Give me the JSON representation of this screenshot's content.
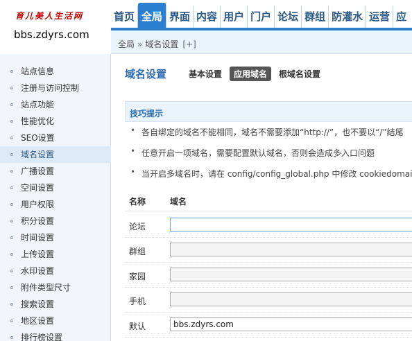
{
  "logo": {
    "calligraphy": "育儿美人生活网",
    "domain": "bbs.zdyrs.com"
  },
  "topnav": [
    "首页",
    "全局",
    "界面",
    "内容",
    "用户",
    "门户",
    "论坛",
    "群组",
    "防灌水",
    "运营",
    "应"
  ],
  "breadcrumb": {
    "root": "全局",
    "separator": "»",
    "current": "域名设置",
    "add": "[+]"
  },
  "sidebar": {
    "items": [
      "站点信息",
      "注册与访问控制",
      "站点功能",
      "性能优化",
      "SEO设置",
      "域名设置",
      "广播设置",
      "空间设置",
      "用户权限",
      "积分设置",
      "时间设置",
      "上传设置",
      "水印设置",
      "附件类型尺寸",
      "搜索设置",
      "地区设置",
      "排行榜设置"
    ],
    "active_index": 5
  },
  "main": {
    "title": "域名设置",
    "tabs": [
      "基本设置",
      "应用域名",
      "根域名设置"
    ],
    "active_tab": 1,
    "tips_title": "技巧提示",
    "tips": [
      "各自绑定的域名不能相同，域名不需要添加“http://”，也不要以“/”结尾",
      "任意开启一项域名，需要配置默认域名，否则会造成多入口问题",
      "当开启多域名时，请在 config/config_global.php 中修改 cookiedomain"
    ],
    "table_headers": {
      "name": "名称",
      "domain": "域名"
    },
    "rows": [
      {
        "label": "论坛",
        "value": ""
      },
      {
        "label": "群组",
        "value": ""
      },
      {
        "label": "家园",
        "value": ""
      },
      {
        "label": "手机",
        "value": ""
      },
      {
        "label": "默认",
        "value": "bbs.zdyrs.com"
      }
    ]
  },
  "colors": {
    "accent": "#2b7fd0",
    "title_blue": "#2b6cb2",
    "sidebar_bg": "#f1f6fc",
    "logo_red": "#c00000"
  }
}
